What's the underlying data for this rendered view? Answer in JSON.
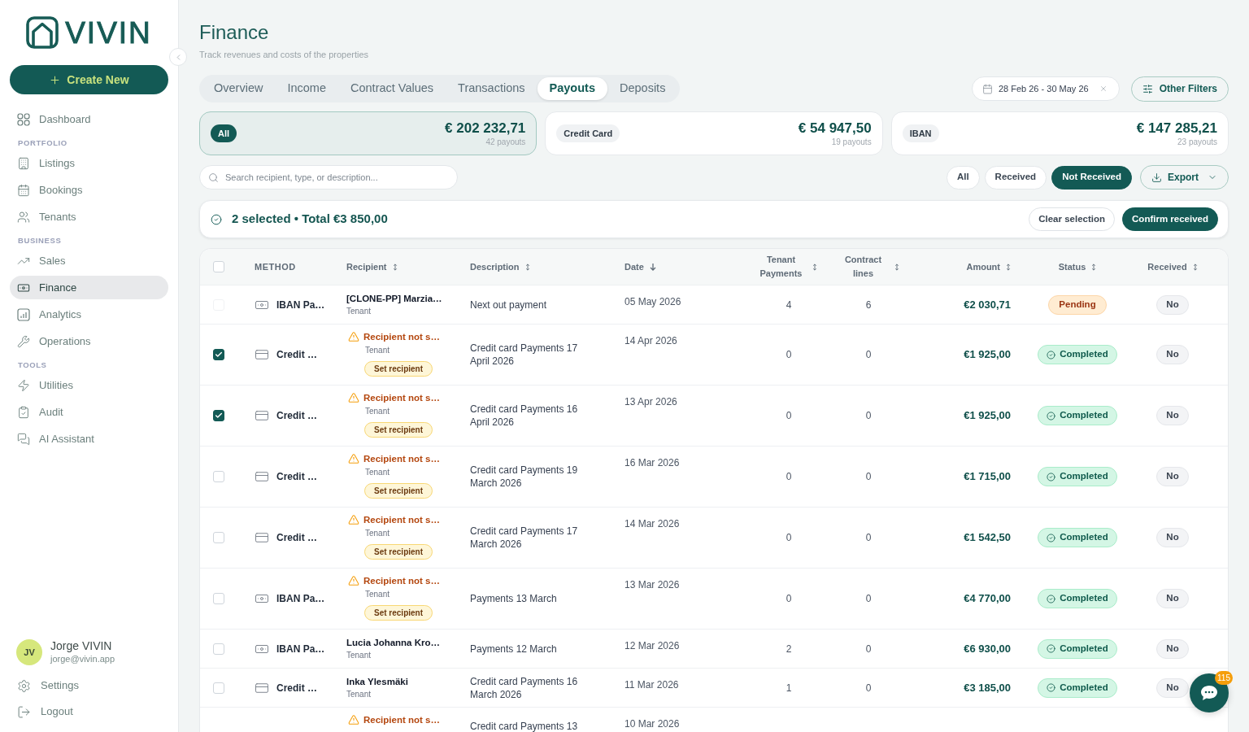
{
  "sidebar": {
    "logo": "VIVIN",
    "create_button": "Create New",
    "sections": [
      {
        "items": [
          {
            "label": "Dashboard",
            "selected": false
          }
        ]
      },
      {
        "title": "PORTFOLIO",
        "items": [
          {
            "label": "Listings",
            "selected": false
          },
          {
            "label": "Bookings",
            "selected": false
          },
          {
            "label": "Tenants",
            "selected": false
          }
        ]
      },
      {
        "title": "BUSINESS",
        "items": [
          {
            "label": "Sales",
            "selected": false
          },
          {
            "label": "Finance",
            "selected": true
          },
          {
            "label": "Analytics",
            "selected": false
          },
          {
            "label": "Operations",
            "selected": false
          }
        ]
      },
      {
        "title": "TOOLS",
        "items": [
          {
            "label": "Utilities",
            "selected": false
          },
          {
            "label": "Audit",
            "selected": false
          },
          {
            "label": "AI Assistant",
            "selected": false
          }
        ]
      }
    ],
    "user": {
      "initials": "JV",
      "name": "Jorge VIVIN",
      "email": "jorge@vivin.app"
    },
    "footer_items": [
      {
        "label": "Settings"
      },
      {
        "label": "Logout"
      }
    ]
  },
  "header": {
    "title": "Finance",
    "subtitle": "Track revenues and costs of the properties"
  },
  "tabs": [
    {
      "label": "Overview",
      "selected": false
    },
    {
      "label": "Income",
      "selected": false
    },
    {
      "label": "Contract Values",
      "selected": false
    },
    {
      "label": "Transactions",
      "selected": false
    },
    {
      "label": "Payouts",
      "selected": true
    },
    {
      "label": "Deposits",
      "selected": false
    }
  ],
  "date_range": {
    "value": "28 Feb 26 - 30 May 26"
  },
  "other_filters": {
    "label": "Other Filters"
  },
  "summary_cards": [
    {
      "label": "All",
      "amount": "€ 202 232,71",
      "count": "42 payouts",
      "selected": true
    },
    {
      "label": "Credit Card",
      "amount": "€ 54 947,50",
      "count": "19 payouts",
      "selected": false
    },
    {
      "label": "IBAN",
      "amount": "€ 147 285,21",
      "count": "23 payouts",
      "selected": false
    }
  ],
  "search": {
    "placeholder": "Search recipient, type, or description..."
  },
  "received_filter": [
    {
      "label": "All",
      "selected": false
    },
    {
      "label": "Received",
      "selected": false
    },
    {
      "label": "Not Received",
      "selected": true
    }
  ],
  "export": {
    "label": "Export"
  },
  "selection_bar": {
    "summary": "2 selected • Total €3 850,00",
    "buttons": [
      {
        "label": "Clear selection",
        "kind": "secondary"
      },
      {
        "label": "Confirm received",
        "kind": "primary"
      }
    ]
  },
  "table": {
    "select_all": {
      "checked": false
    },
    "columns": [
      {
        "label": "METHOD",
        "sortable": false,
        "sorted": false
      },
      {
        "label": "Recipient",
        "sortable": true,
        "sorted": false
      },
      {
        "label": "Description",
        "sortable": true,
        "sorted": false
      },
      {
        "label": "Date",
        "sortable": false,
        "sorted": true
      },
      {
        "label": "Tenant Payments",
        "sortable": true,
        "sorted": false
      },
      {
        "label": "Contract lines",
        "sortable": true,
        "sorted": false
      },
      {
        "label": "Amount",
        "sortable": true,
        "sorted": false
      },
      {
        "label": "Status",
        "sortable": true,
        "sorted": false
      },
      {
        "label": "Received",
        "sortable": true,
        "sorted": false
      }
    ],
    "rows": [
      {
        "checked": false,
        "disabled": true,
        "method": {
          "kind": "iban",
          "label": "IBAN Pa…"
        },
        "recipient": {
          "kind": "named",
          "name": "[CLONE-PP] Marzia…",
          "role": "Tenant"
        },
        "description": "Next out payment",
        "date": "05 May 2026",
        "tenant_payments": "4",
        "contract_lines": "6",
        "amount": "€2 030,71",
        "status": {
          "kind": "pending",
          "label": "Pending"
        },
        "received": "No"
      },
      {
        "checked": true,
        "disabled": false,
        "method": {
          "kind": "card",
          "label": "Credit …"
        },
        "recipient": {
          "kind": "missing",
          "name": "Recipient not s…",
          "role": "Tenant",
          "action": "Set recipient"
        },
        "description": "Credit card Payments 17 April 2026",
        "date": "14 Apr 2026",
        "tenant_payments": "0",
        "contract_lines": "0",
        "amount": "€1 925,00",
        "status": {
          "kind": "completed",
          "label": "Completed"
        },
        "received": "No"
      },
      {
        "checked": true,
        "disabled": false,
        "method": {
          "kind": "card",
          "label": "Credit …"
        },
        "recipient": {
          "kind": "missing",
          "name": "Recipient not s…",
          "role": "Tenant",
          "action": "Set recipient"
        },
        "description": "Credit card Payments 16 April 2026",
        "date": "13 Apr 2026",
        "tenant_payments": "0",
        "contract_lines": "0",
        "amount": "€1 925,00",
        "status": {
          "kind": "completed",
          "label": "Completed"
        },
        "received": "No"
      },
      {
        "checked": false,
        "disabled": false,
        "method": {
          "kind": "card",
          "label": "Credit …"
        },
        "recipient": {
          "kind": "missing",
          "name": "Recipient not s…",
          "role": "Tenant",
          "action": "Set recipient"
        },
        "description": "Credit card Payments 19 March 2026",
        "date": "16 Mar 2026",
        "tenant_payments": "0",
        "contract_lines": "0",
        "amount": "€1 715,00",
        "status": {
          "kind": "completed",
          "label": "Completed"
        },
        "received": "No"
      },
      {
        "checked": false,
        "disabled": false,
        "method": {
          "kind": "card",
          "label": "Credit …"
        },
        "recipient": {
          "kind": "missing",
          "name": "Recipient not s…",
          "role": "Tenant",
          "action": "Set recipient"
        },
        "description": "Credit card Payments 17 March 2026",
        "date": "14 Mar 2026",
        "tenant_payments": "0",
        "contract_lines": "0",
        "amount": "€1 542,50",
        "status": {
          "kind": "completed",
          "label": "Completed"
        },
        "received": "No"
      },
      {
        "checked": false,
        "disabled": false,
        "method": {
          "kind": "iban",
          "label": "IBAN Pa…"
        },
        "recipient": {
          "kind": "missing",
          "name": "Recipient not s…",
          "role": "Tenant",
          "action": "Set recipient"
        },
        "description": "Payments 13 March",
        "date": "13 Mar 2026",
        "tenant_payments": "0",
        "contract_lines": "0",
        "amount": "€4 770,00",
        "status": {
          "kind": "completed",
          "label": "Completed"
        },
        "received": "No"
      },
      {
        "checked": false,
        "disabled": false,
        "method": {
          "kind": "iban",
          "label": "IBAN Pa…"
        },
        "recipient": {
          "kind": "named",
          "name": "Lucia Johanna Kro…",
          "role": "Tenant"
        },
        "description": "Payments 12 March",
        "date": "12 Mar 2026",
        "tenant_payments": "2",
        "contract_lines": "0",
        "amount": "€6 930,00",
        "status": {
          "kind": "completed",
          "label": "Completed"
        },
        "received": "No"
      },
      {
        "checked": false,
        "disabled": false,
        "method": {
          "kind": "card",
          "label": "Credit …"
        },
        "recipient": {
          "kind": "named",
          "name": "Inka Ylesmäki",
          "role": "Tenant"
        },
        "description": "Credit card Payments 16 March 2026",
        "date": "11 Mar 2026",
        "tenant_payments": "1",
        "contract_lines": "0",
        "amount": "€3 185,00",
        "status": {
          "kind": "completed",
          "label": "Completed"
        },
        "received": "No"
      },
      {
        "recipient": {
          "kind": "missing",
          "name": "Recipient not s…"
        },
        "description": "Credit card Payments 13",
        "date": "10 Mar 2026"
      }
    ]
  },
  "chat": {
    "badge": "115"
  }
}
